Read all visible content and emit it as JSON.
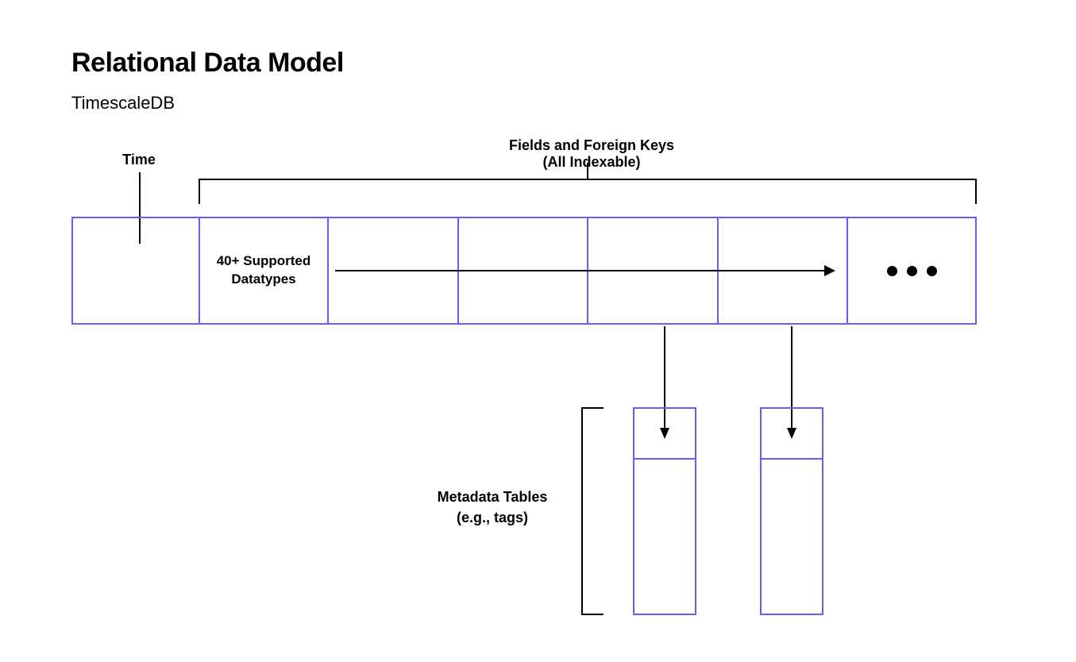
{
  "title": "Relational Data Model",
  "subtitle": "TimescaleDB",
  "labels": {
    "time": "Time",
    "fields_l1": "Fields and Foreign Keys",
    "fields_l2": "(All Indexable)",
    "datatypes": "40+ Supported Datatypes",
    "meta_l1": "Metadata Tables",
    "meta_l2": "(e.g., tags)"
  },
  "colors": {
    "box_border": "#6b5cff",
    "line": "#000000"
  }
}
